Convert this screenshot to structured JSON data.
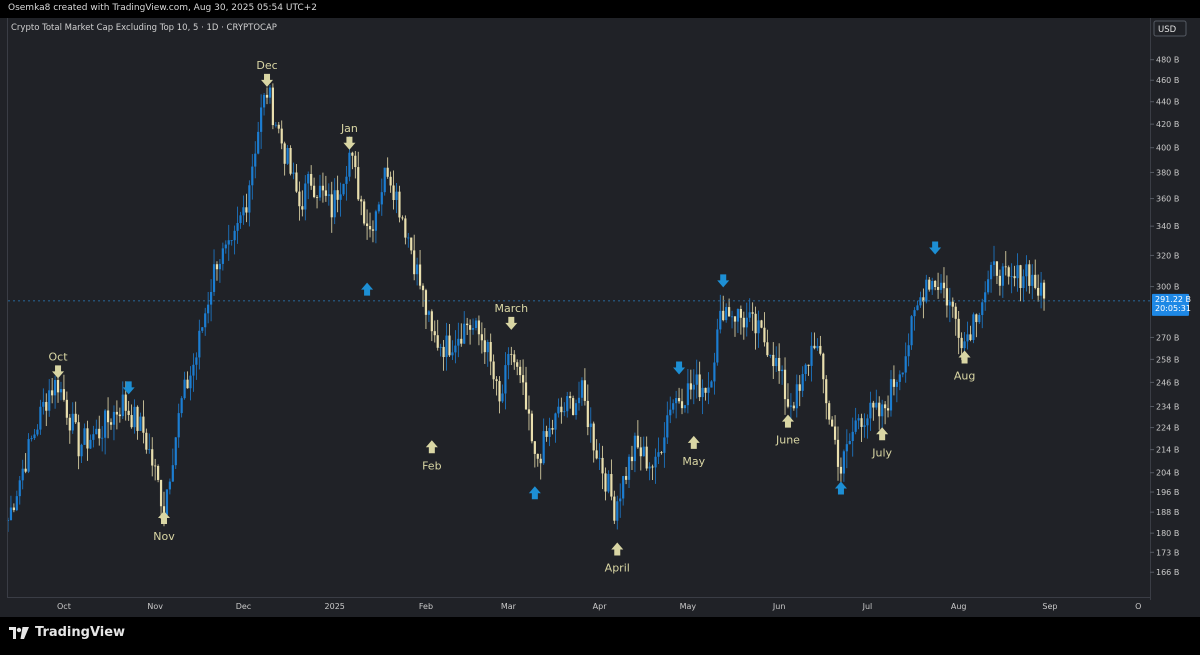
{
  "credit": "Osemka8 created with TradingView.com, Aug 30, 2025 05:54 UTC+2",
  "brand": "TradingView",
  "colors": {
    "background": "#202227",
    "candle_up": "#1c7dd1",
    "candle_down": "#e9dfae",
    "label": "#d9d6a4",
    "arrow_blue": "#1d8fd4",
    "price_tag": "#1e88e5"
  },
  "chart_data": {
    "type": "candlestick",
    "title": "Crypto Total Market Cap Excluding Top 10, 5 · 1D · CRYPTOCAP",
    "currency": "USD",
    "y_scale": "log",
    "ylim": [
      160,
      500
    ],
    "y_ticks": [
      480,
      460,
      440,
      420,
      400,
      380,
      360,
      340,
      320,
      300,
      270,
      258,
      246,
      234,
      224,
      214,
      204,
      196,
      188,
      180,
      173,
      166
    ],
    "y_unit": "B",
    "x_ticks": [
      "Oct",
      "Nov",
      "Dec",
      "2025",
      "Feb",
      "Mar",
      "Apr",
      "May",
      "Jun",
      "Jul",
      "Aug",
      "Sep",
      "O"
    ],
    "x_range": [
      "2024-09-12",
      "2025-10-05"
    ],
    "last_price": "291.22 B",
    "countdown": "20:05:31",
    "path_key_points": [
      [
        "2024-09-12",
        185
      ],
      [
        "2024-09-20",
        218
      ],
      [
        "2024-09-26",
        242
      ],
      [
        "2024-09-29",
        246
      ],
      [
        "2024-10-06",
        216
      ],
      [
        "2024-10-13",
        222
      ],
      [
        "2024-10-21",
        236
      ],
      [
        "2024-10-28",
        222
      ],
      [
        "2024-11-04",
        190
      ],
      [
        "2024-11-10",
        236
      ],
      [
        "2024-11-15",
        260
      ],
      [
        "2024-11-22",
        318
      ],
      [
        "2024-11-27",
        322
      ],
      [
        "2024-12-02",
        360
      ],
      [
        "2024-12-07",
        430
      ],
      [
        "2024-12-09",
        450
      ],
      [
        "2024-12-14",
        405
      ],
      [
        "2024-12-20",
        355
      ],
      [
        "2024-12-24",
        375
      ],
      [
        "2024-12-31",
        352
      ],
      [
        "2025-01-06",
        395
      ],
      [
        "2025-01-10",
        358
      ],
      [
        "2025-01-13",
        338
      ],
      [
        "2025-01-19",
        385
      ],
      [
        "2025-01-27",
        325
      ],
      [
        "2025-02-03",
        270
      ],
      [
        "2025-02-08",
        265
      ],
      [
        "2025-02-15",
        278
      ],
      [
        "2025-02-21",
        268
      ],
      [
        "2025-02-26",
        234
      ],
      [
        "2025-03-02",
        262
      ],
      [
        "2025-03-06",
        240
      ],
      [
        "2025-03-10",
        208
      ],
      [
        "2025-03-18",
        230
      ],
      [
        "2025-03-26",
        240
      ],
      [
        "2025-03-30",
        218
      ],
      [
        "2025-04-06",
        190
      ],
      [
        "2025-04-13",
        215
      ],
      [
        "2025-04-20",
        206
      ],
      [
        "2025-04-25",
        236
      ],
      [
        "2025-05-03",
        244
      ],
      [
        "2025-05-08",
        245
      ],
      [
        "2025-05-13",
        288
      ],
      [
        "2025-05-22",
        278
      ],
      [
        "2025-05-29",
        265
      ],
      [
        "2025-06-04",
        236
      ],
      [
        "2025-06-08",
        240
      ],
      [
        "2025-06-13",
        270
      ],
      [
        "2025-06-18",
        230
      ],
      [
        "2025-06-22",
        205
      ],
      [
        "2025-06-28",
        230
      ],
      [
        "2025-07-06",
        230
      ],
      [
        "2025-07-14",
        262
      ],
      [
        "2025-07-21",
        305
      ],
      [
        "2025-07-26",
        302
      ],
      [
        "2025-08-03",
        268
      ],
      [
        "2025-08-08",
        290
      ],
      [
        "2025-08-14",
        313
      ],
      [
        "2025-08-18",
        300
      ],
      [
        "2025-08-24",
        312
      ],
      [
        "2025-08-30",
        291
      ]
    ],
    "annotations": [
      {
        "text": "Oct",
        "date": "2024-09-29",
        "value": 246,
        "marker": "arrow-down",
        "color": "label"
      },
      {
        "text": "",
        "date": "2024-10-23",
        "value": 238,
        "marker": "arrow-down",
        "color": "arrow_blue"
      },
      {
        "text": "Nov",
        "date": "2024-11-04",
        "value": 190,
        "marker": "arrow-up",
        "color": "label"
      },
      {
        "text": "Dec",
        "date": "2024-12-09",
        "value": 450,
        "marker": "arrow-down",
        "color": "label"
      },
      {
        "text": "Jan",
        "date": "2025-01-06",
        "value": 395,
        "marker": "arrow-down",
        "color": "label"
      },
      {
        "text": "",
        "date": "2025-01-12",
        "value": 305,
        "marker": "arrow-up",
        "color": "arrow_blue"
      },
      {
        "text": "Feb",
        "date": "2025-02-03",
        "value": 220,
        "marker": "arrow-up",
        "color": "label"
      },
      {
        "text": "March",
        "date": "2025-03-02",
        "value": 272,
        "marker": "arrow-down",
        "color": "label"
      },
      {
        "text": "",
        "date": "2025-03-10",
        "value": 200,
        "marker": "arrow-up",
        "color": "arrow_blue"
      },
      {
        "text": "April",
        "date": "2025-04-07",
        "value": 178,
        "marker": "arrow-up",
        "color": "label"
      },
      {
        "text": "",
        "date": "2025-04-28",
        "value": 248,
        "marker": "arrow-down",
        "color": "arrow_blue"
      },
      {
        "text": "May",
        "date": "2025-05-03",
        "value": 222,
        "marker": "arrow-up",
        "color": "label"
      },
      {
        "text": "",
        "date": "2025-05-13",
        "value": 297,
        "marker": "arrow-down",
        "color": "arrow_blue"
      },
      {
        "text": "June",
        "date": "2025-06-04",
        "value": 232,
        "marker": "arrow-up",
        "color": "label"
      },
      {
        "text": "",
        "date": "2025-06-22",
        "value": 202,
        "marker": "arrow-up",
        "color": "arrow_blue"
      },
      {
        "text": "July",
        "date": "2025-07-06",
        "value": 226,
        "marker": "arrow-up",
        "color": "label"
      },
      {
        "text": "",
        "date": "2025-07-24",
        "value": 318,
        "marker": "arrow-down",
        "color": "arrow_blue"
      },
      {
        "text": "Aug",
        "date": "2025-08-03",
        "value": 265,
        "marker": "arrow-up",
        "color": "label"
      }
    ]
  }
}
